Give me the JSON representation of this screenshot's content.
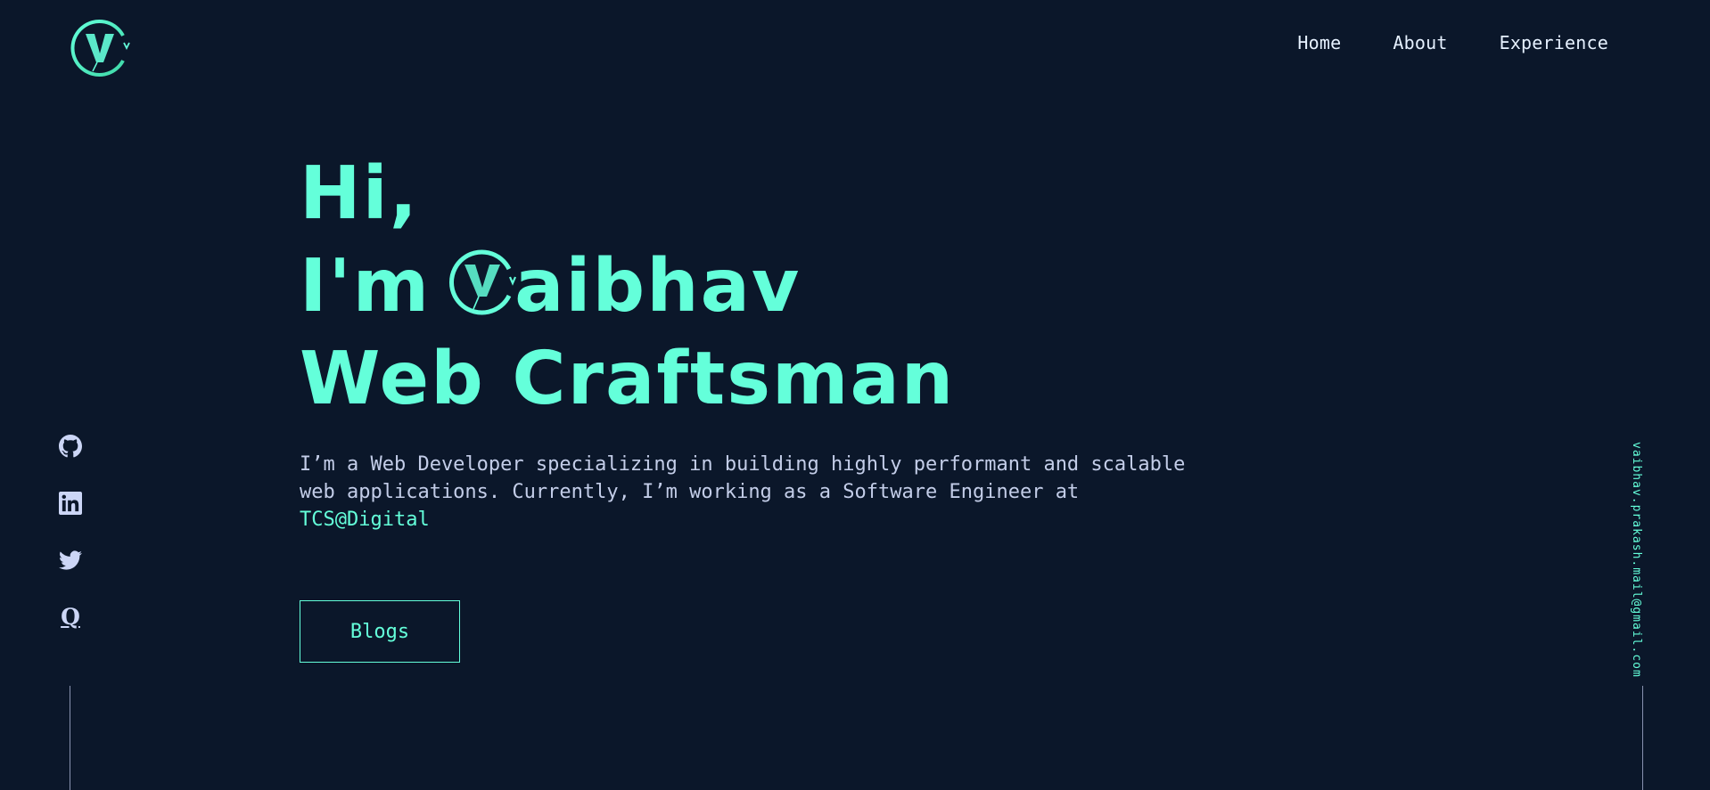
{
  "nav": {
    "items": [
      {
        "label": "Home"
      },
      {
        "label": "About"
      },
      {
        "label": "Experience"
      }
    ]
  },
  "hero": {
    "line1": "Hi,",
    "line2_prefix": "I'm",
    "line2_name_rest": "aibhav",
    "line3": "Web Craftsman",
    "description": "I’m a Web Developer specializing in building highly performant and scalable web applications. Currently, I’m working as a Software Engineer at",
    "company": "TCS@Digital"
  },
  "blogs_button": {
    "label": "Blogs"
  },
  "social": [
    {
      "icon": "github-icon"
    },
    {
      "icon": "linkedin-icon"
    },
    {
      "icon": "twitter-icon"
    },
    {
      "icon": "quora-icon",
      "glyph": "Q"
    }
  ],
  "email": "vaibhav.prakash.mail@gmail.com",
  "colors": {
    "background": "#0b172a",
    "accent": "#64ffda",
    "text": "#ccd6f6"
  }
}
